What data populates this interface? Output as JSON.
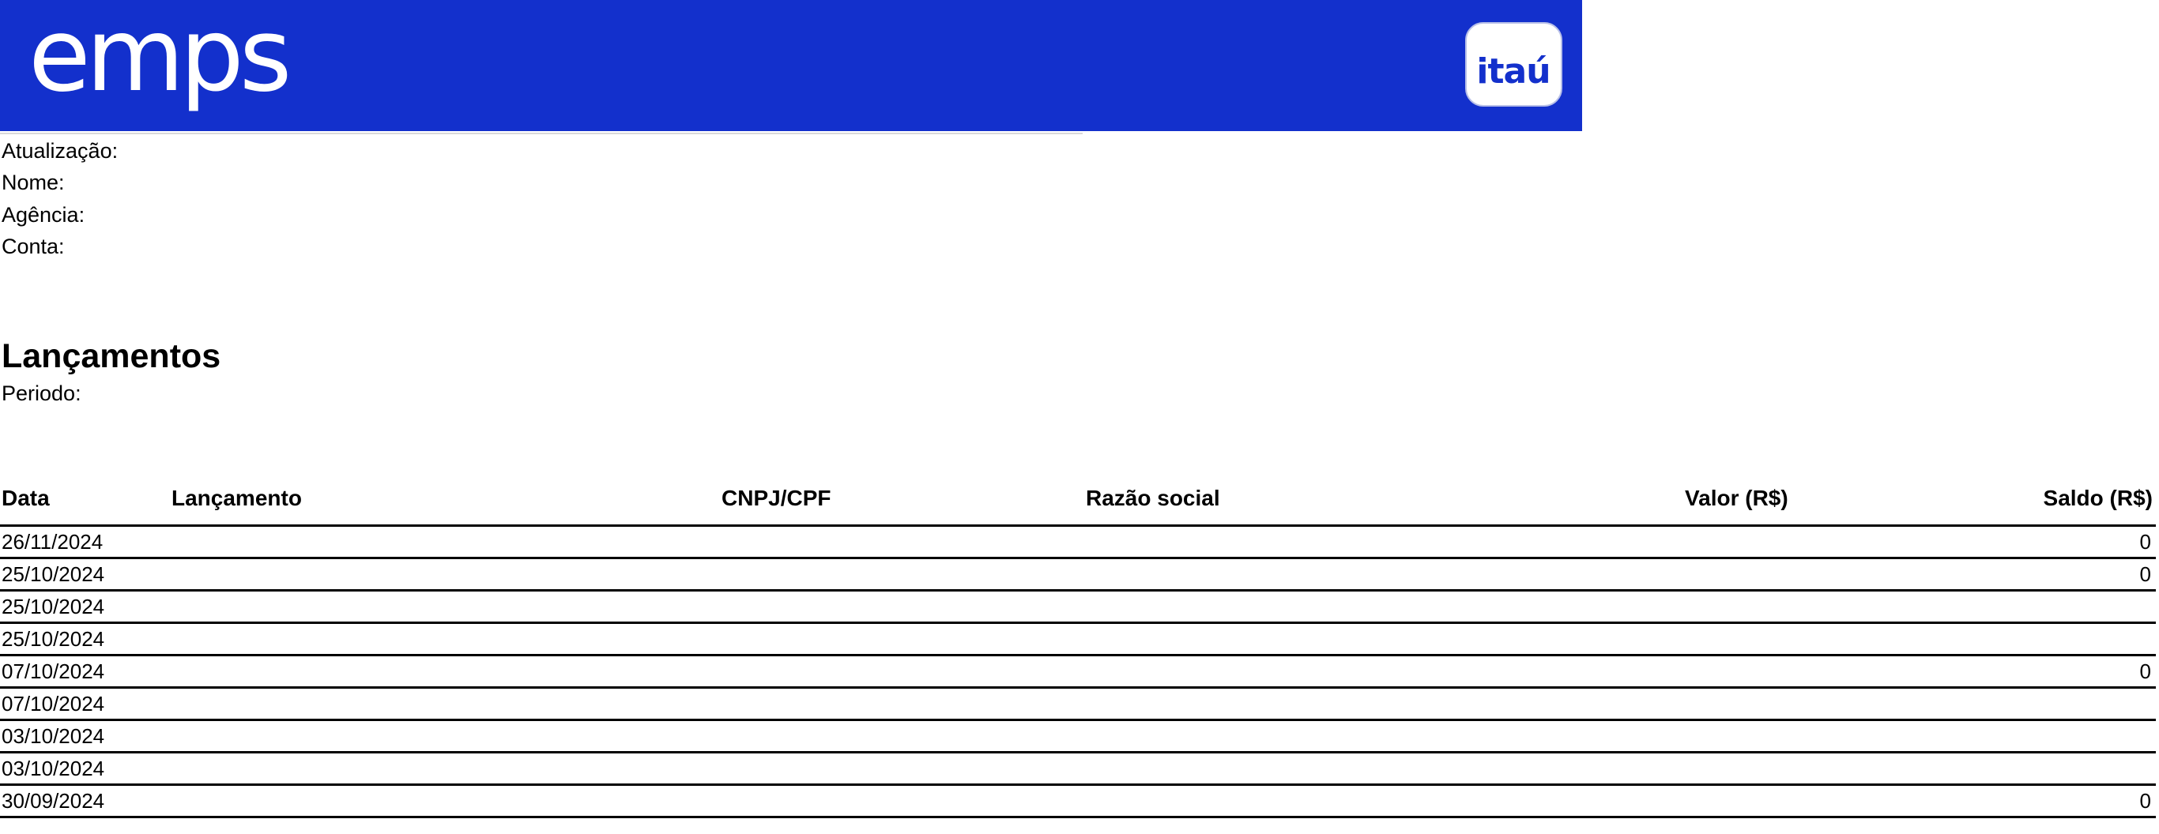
{
  "header": {
    "brand_text": "emps",
    "bank_text": "itaú",
    "banner_color": "#1330CC"
  },
  "info": {
    "atualizacao_label": "Atualização:",
    "nome_label": "Nome:",
    "agencia_label": "Agência:",
    "conta_label": "Conta:"
  },
  "section": {
    "title": "Lançamentos",
    "periodo_label": "Periodo:"
  },
  "table": {
    "columns": [
      "Data",
      "Lançamento",
      "CNPJ/CPF",
      "Razão social",
      "Valor (R$)",
      "Saldo (R$)"
    ],
    "rows": [
      {
        "date": "26/11/2024",
        "saldo": "0"
      },
      {
        "date": "25/10/2024",
        "saldo": "0"
      },
      {
        "date": "25/10/2024",
        "saldo": ""
      },
      {
        "date": "25/10/2024",
        "saldo": ""
      },
      {
        "date": "07/10/2024",
        "saldo": "0"
      },
      {
        "date": "07/10/2024",
        "saldo": ""
      },
      {
        "date": "03/10/2024",
        "saldo": ""
      },
      {
        "date": "03/10/2024",
        "saldo": ""
      },
      {
        "date": "30/09/2024",
        "saldo": "0"
      }
    ]
  }
}
